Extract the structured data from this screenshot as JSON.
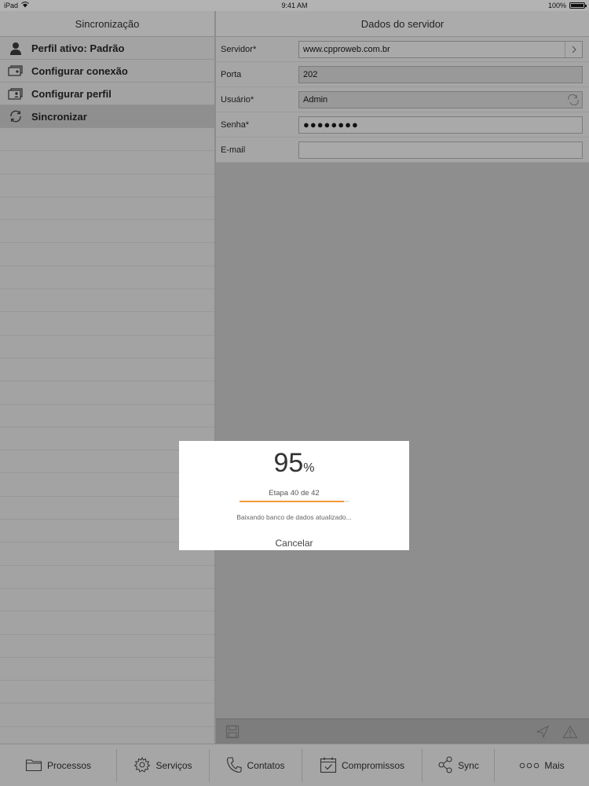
{
  "status_bar": {
    "device": "iPad",
    "time": "9:41 AM",
    "battery": "100%"
  },
  "left_pane": {
    "title": "Sincronização",
    "items": [
      {
        "label": "Perfil ativo: Padrão",
        "icon": "user-icon"
      },
      {
        "label": "Configurar conexão",
        "icon": "connection-icon"
      },
      {
        "label": "Configurar perfil",
        "icon": "profile-card-icon"
      },
      {
        "label": "Sincronizar",
        "icon": "sync-icon",
        "selected": true
      }
    ]
  },
  "right_pane": {
    "title": "Dados do servidor",
    "fields": {
      "servidor": {
        "label": "Servidor*",
        "value": "www.cpproweb.com.br"
      },
      "porta": {
        "label": "Porta",
        "value": "202"
      },
      "usuario": {
        "label": "Usuário*",
        "value": "Admin"
      },
      "senha": {
        "label": "Senha*",
        "value": "●●●●●●●●"
      },
      "email": {
        "label": "E-mail",
        "value": ""
      }
    }
  },
  "dialog": {
    "percent": "95",
    "percent_symbol": "%",
    "progress": 0.95,
    "step": "Etapa 40 de 42",
    "message": "Baixando banco de dados atualizado...",
    "cancel_label": "Cancelar"
  },
  "tab_bar": {
    "tabs": [
      {
        "label": "Processos",
        "icon": "folder-icon"
      },
      {
        "label": "Serviços",
        "icon": "gear-icon"
      },
      {
        "label": "Contatos",
        "icon": "phone-icon"
      },
      {
        "label": "Compromissos",
        "icon": "calendar-icon"
      },
      {
        "label": "Sync",
        "icon": "sync-share-icon"
      },
      {
        "label": "Mais",
        "icon": "more-icon"
      }
    ]
  },
  "colors": {
    "accent": "#f29a39",
    "overlay": "#8e8e8e"
  }
}
